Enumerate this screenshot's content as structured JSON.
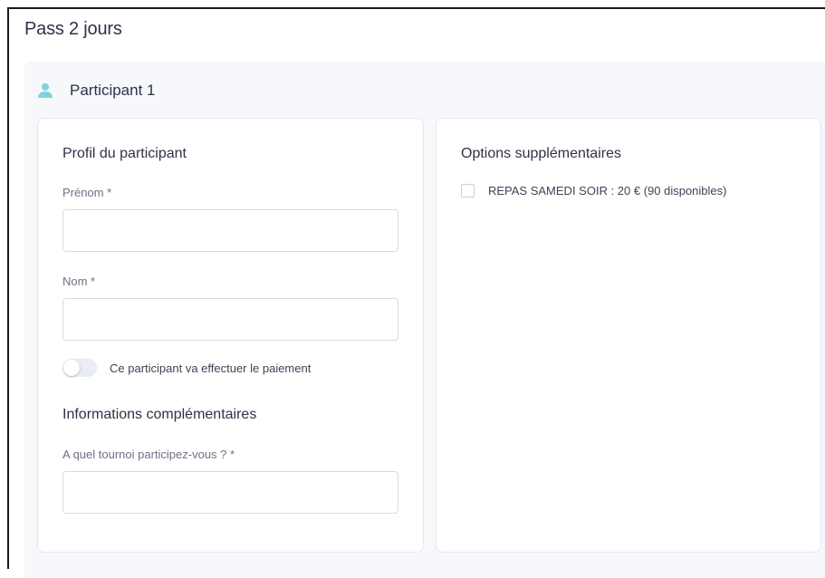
{
  "page": {
    "title": "Pass 2 jours"
  },
  "participant": {
    "title": "Participant 1",
    "icon": "person-icon",
    "accent_color": "#7fd3dc"
  },
  "profile": {
    "title": "Profil du participant",
    "first_name": {
      "label": "Prénom *",
      "value": ""
    },
    "last_name": {
      "label": "Nom *",
      "value": ""
    },
    "payer_toggle": {
      "label": "Ce participant va effectuer le paiement",
      "checked": false
    }
  },
  "additional": {
    "title": "Informations complémentaires",
    "tournament": {
      "label": "A quel tournoi participez-vous ? *",
      "value": ""
    }
  },
  "options": {
    "title": "Options supplémentaires",
    "items": [
      {
        "label": "REPAS SAMEDI SOIR : 20 € (90 disponibles)",
        "checked": false
      }
    ]
  }
}
